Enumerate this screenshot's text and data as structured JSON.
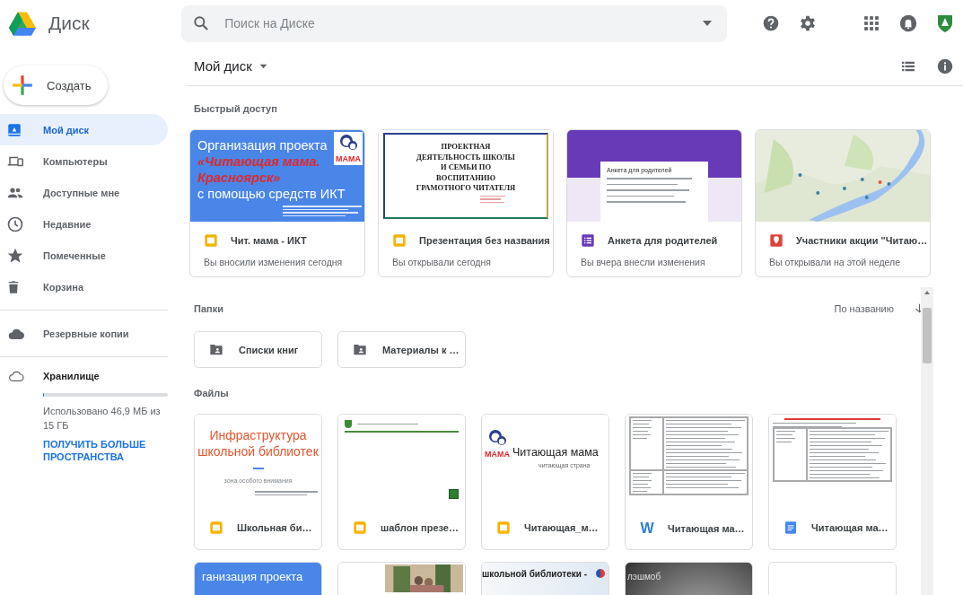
{
  "app": {
    "title": "Диск"
  },
  "search": {
    "placeholder": "Поиск на Диске"
  },
  "new_button": {
    "label": "Создать"
  },
  "sidebar": {
    "sections": [
      {
        "items": [
          {
            "label": "Мой диск",
            "kind": "drive",
            "selected": true
          },
          {
            "label": "Компьютеры",
            "kind": "computers",
            "selected": false
          },
          {
            "label": "Доступные мне",
            "kind": "shared",
            "selected": false
          },
          {
            "label": "Недавние",
            "kind": "recent",
            "selected": false
          },
          {
            "label": "Помеченные",
            "kind": "starred",
            "selected": false
          },
          {
            "label": "Корзина",
            "kind": "trash",
            "selected": false
          }
        ]
      },
      {
        "items": [
          {
            "label": "Резервные копии",
            "kind": "backups",
            "selected": false
          }
        ]
      }
    ],
    "storage": {
      "label": "Хранилище",
      "level": 0.003,
      "usage": "Использовано 46,9 МБ из 15 ГБ",
      "upgrade": "ПОЛУЧИТЬ БОЛЬШЕ ПРОСТРАНСТВА"
    }
  },
  "breadcrumb": {
    "title": "Мой диск"
  },
  "quick_access": {
    "title": "Быстрый доступ",
    "items": [
      {
        "name": "Чит. мама - ИКТ",
        "activity": "Вы вносили изменения сегодня",
        "kind": "slides",
        "preview": {
          "kind": "blue-title",
          "lines": [
            {
              "text": "Организация проекта",
              "accent": false
            },
            {
              "text": "«Читающая мама.",
              "accent": true
            },
            {
              "text": "Красноярск»",
              "accent": true
            },
            {
              "text": "с помощью средств ИКТ",
              "accent": false
            }
          ],
          "logo": "МАМА"
        }
      },
      {
        "name": "Презентация без названия",
        "activity": "Вы открывали сегодня",
        "kind": "slides",
        "preview": {
          "kind": "framed",
          "lines": [
            "ПРОЕКТНАЯ",
            "ДЕЯТЕЛЬНОСТЬ ШКОЛЫ",
            "И СЕМЬИ ПО",
            "ВОСПИТАНИЮ",
            "ГРАМОТНОГО ЧИТАТЕЛЯ"
          ]
        }
      },
      {
        "name": "Анкета для родителей",
        "activity": "Вы вчера внесли изменения",
        "kind": "forms",
        "preview": {
          "kind": "form",
          "title": "Анкета для родителей"
        }
      },
      {
        "name": "Участники акции \"Читаю…",
        "activity": "Вы открывали на этой неделе",
        "kind": "maps",
        "preview": {
          "kind": "picture"
        }
      }
    ]
  },
  "folders": {
    "title": "Папки",
    "sort": "По названию",
    "items": [
      {
        "name": "Списки книг"
      },
      {
        "name": "Материалы к …"
      }
    ]
  },
  "files": {
    "title": "Файлы",
    "items": [
      {
        "name": "Школьная би…",
        "kind": "slides",
        "preview": {
          "kind": "white-title",
          "lines": [
            "Инфраструктура",
            "школьной библиотек"
          ],
          "subtitle": "зона особого внимания"
        }
      },
      {
        "name": "шаблон презе…",
        "kind": "slides",
        "preview": {
          "kind": "template"
        }
      },
      {
        "name": "Читающая_м…",
        "kind": "slides",
        "preview": {
          "kind": "logo-title",
          "logo": "МАМА",
          "title": "Читающая мама",
          "subtitle": "читающая страна"
        }
      },
      {
        "name": "Читающая ма…",
        "kind": "word",
        "icon_text": "W",
        "preview": {
          "kind": "table-doc"
        }
      },
      {
        "name": "Читающая ма…",
        "kind": "docs",
        "preview": {
          "kind": "red-doc"
        }
      },
      {
        "preview": {
          "kind": "blue-title",
          "lines": [
            {
              "text": "ганизация проекта",
              "accent": false
            }
          ]
        }
      },
      {
        "preview": {
          "kind": "picture"
        }
      },
      {
        "preview": {
          "kind": "banner",
          "title": "школьной библиотеки -"
        }
      },
      {
        "preview": {
          "kind": "dark",
          "title": "лэшмоб"
        }
      },
      {
        "preview": {
          "kind": "blank"
        }
      }
    ]
  }
}
